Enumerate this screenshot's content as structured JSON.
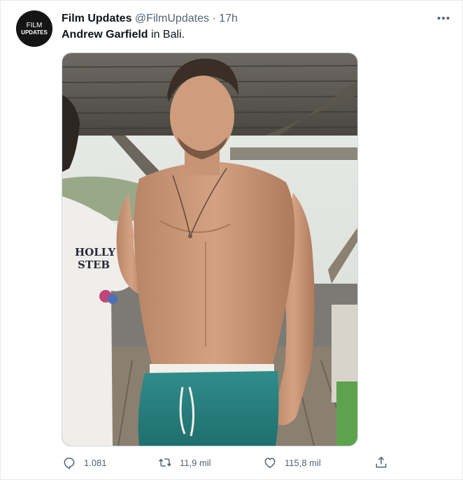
{
  "tweet": {
    "author_name": "Film Updates",
    "author_handle": "@FilmUpdates",
    "separator": "·",
    "time": "17h",
    "text_bold": "Andrew Garfield",
    "text_rest": " in Bali.",
    "avatar_text_top": "FILM",
    "avatar_text_bottom": "UPDATES"
  },
  "media": {
    "shirt_text_line1": "HOLLY",
    "shirt_text_line2": "STEB"
  },
  "actions": {
    "reply_count": "1.081",
    "retweet_count": "11,9 mil",
    "like_count": "115,8 mil"
  },
  "icons": {
    "more": "more-horizontal-icon",
    "reply": "reply-icon",
    "retweet": "retweet-icon",
    "like": "heart-icon",
    "share": "share-icon"
  },
  "colors": {
    "text_primary": "#0f1419",
    "text_secondary": "#536471",
    "border": "#cfd9de"
  }
}
